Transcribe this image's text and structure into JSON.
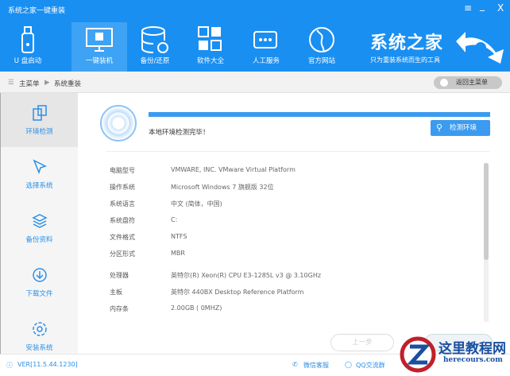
{
  "window": {
    "title": "系统之家一键重装",
    "menu": "≡",
    "minimize": "_",
    "close": "X"
  },
  "nav": [
    {
      "label": "U 盘启动"
    },
    {
      "label": "一键装机"
    },
    {
      "label": "备份/还原"
    },
    {
      "label": "软件大全"
    },
    {
      "label": "人工服务"
    },
    {
      "label": "官方网站"
    }
  ],
  "brand": {
    "name": "系统之家",
    "slogan": "只为重装系统而生的工具"
  },
  "breadcrumb": {
    "home": "主菜单",
    "current": "系统重装",
    "back": "返回主菜单"
  },
  "sidebar": [
    {
      "label": "环境检测"
    },
    {
      "label": "选择系统"
    },
    {
      "label": "备份资料"
    },
    {
      "label": "下载文件"
    },
    {
      "label": "安装系统"
    }
  ],
  "detect": {
    "progress_percent": 100,
    "status": "本地环境检测完毕！",
    "button": "检测环境"
  },
  "info": [
    {
      "k": "电脑型号",
      "v": "VMWARE, INC. VMware Virtual Platform"
    },
    {
      "k": "操作系统",
      "v": "Microsoft Windows 7 旗舰版  32位"
    },
    {
      "k": "系统语言",
      "v": "中文 (简体，中国)"
    },
    {
      "k": "系统盘符",
      "v": "C:"
    },
    {
      "k": "文件格式",
      "v": "NTFS"
    },
    {
      "k": "分区形式",
      "v": "MBR"
    },
    {
      "k": "处理器",
      "v": "英特尔(R) Xeon(R) CPU E3-1285L v3 @ 3.10GHz"
    },
    {
      "k": "主板",
      "v": "英特尔 440BX Desktop Reference Platform"
    },
    {
      "k": "内存条",
      "v": "2.00GB ( 0MHZ)"
    }
  ],
  "buttons": {
    "prev": "上一步"
  },
  "footer": {
    "version": "VER[11.5.44.1230]",
    "wechat": "微信客服",
    "qq": "QQ交流群"
  },
  "watermark": {
    "name": "这里教程网",
    "url": "herecours.com"
  }
}
